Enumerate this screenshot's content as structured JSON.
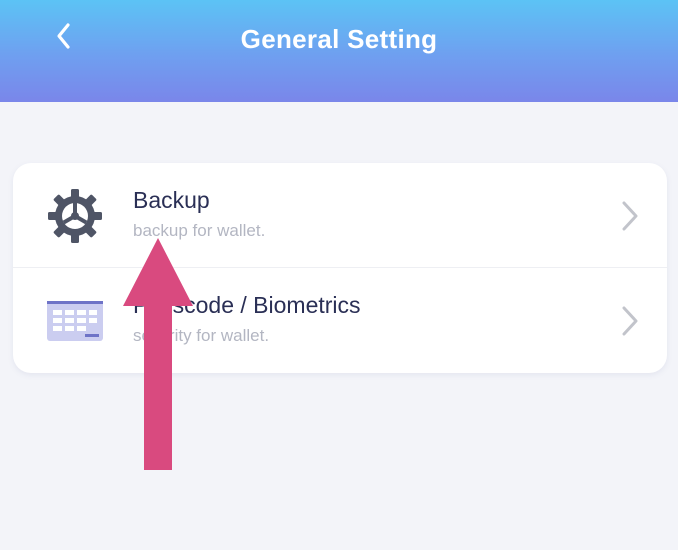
{
  "header": {
    "title": "General Setting",
    "back_icon": "chevron-left-icon"
  },
  "settings": [
    {
      "title": "Backup",
      "subtitle": "backup for wallet.",
      "icon": "gear-icon"
    },
    {
      "title": "Passcode / Biometrics",
      "subtitle": "security for wallet.",
      "icon": "keypad-icon"
    }
  ],
  "colors": {
    "header_gradient_top": "#5cc3f5",
    "header_gradient_bottom": "#7a86ea",
    "annotation_arrow": "#d94a7f"
  }
}
